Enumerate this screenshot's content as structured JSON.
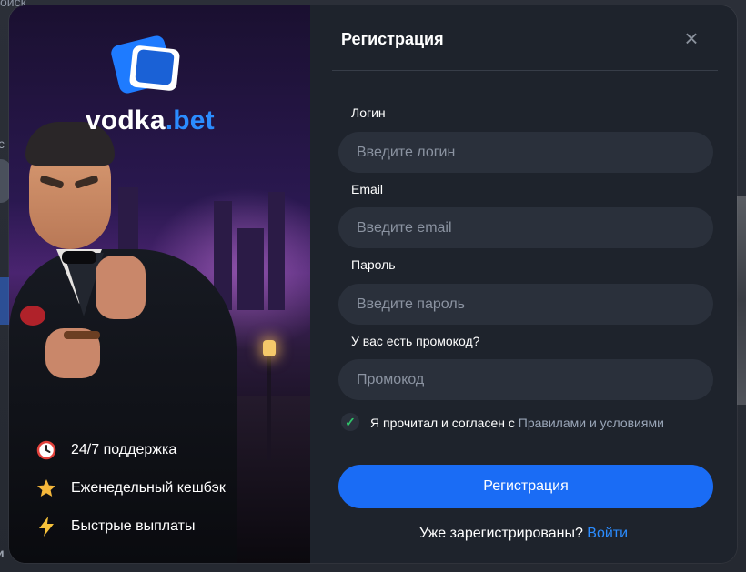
{
  "background": {
    "search_text": "оиск",
    "letter_text": "с",
    "bottom_text": "и"
  },
  "brand": {
    "name": "vodka",
    "suffix": ".bet"
  },
  "features": [
    {
      "icon": "clock-icon",
      "text": "24/7 поддержка"
    },
    {
      "icon": "star-icon",
      "text": "Еженедельный кешбэк"
    },
    {
      "icon": "lightning-icon",
      "text": "Быстрые выплаты"
    }
  ],
  "form": {
    "title": "Регистрация",
    "fields": {
      "login": {
        "label": "Логин",
        "placeholder": "Введите логин",
        "value": ""
      },
      "email": {
        "label": "Email",
        "placeholder": "Введите email",
        "value": ""
      },
      "password": {
        "label": "Пароль",
        "placeholder": "Введите пароль",
        "value": ""
      },
      "promo": {
        "label": "У вас есть промокод?",
        "placeholder": "Промокод",
        "value": ""
      }
    },
    "agreement": {
      "checked": true,
      "text": "Я прочитал и согласен с ",
      "link": "Правилами и условиями"
    },
    "submit_label": "Регистрация",
    "login_prompt": "Уже зарегистрированы? ",
    "login_link": "Войти"
  },
  "colors": {
    "accent": "#1a6cf5",
    "link": "#2b8cff",
    "panel": "#1e232c",
    "input": "#2a303b",
    "check": "#30c46a"
  }
}
